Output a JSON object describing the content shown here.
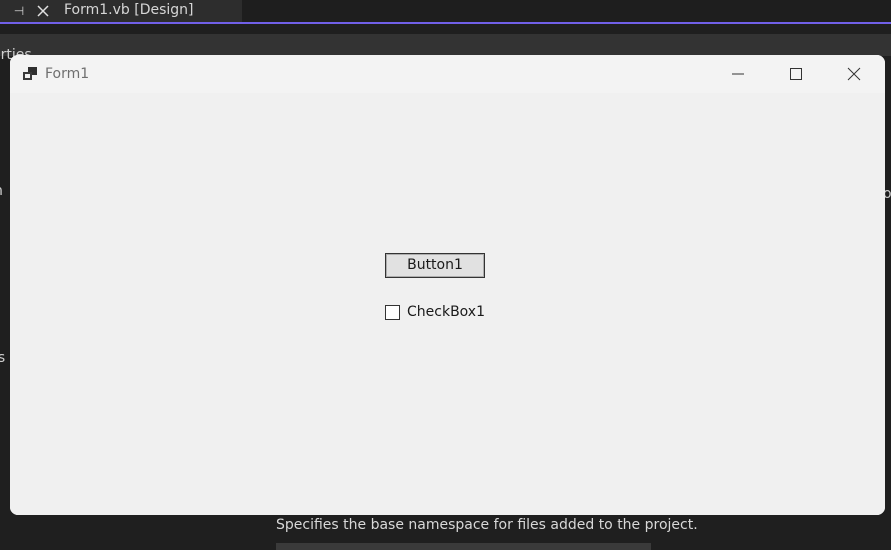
{
  "ide": {
    "tab": {
      "title": "Form1.vb [Design]",
      "pin_icon": "pin-icon",
      "close_icon": "close-icon"
    },
    "panels": {
      "properties_label_fragment": "erties",
      "left_fragment_1": "n",
      "left_fragment_2": "is",
      "right_fragment": "o"
    },
    "accent_color": "#7160e8"
  },
  "form": {
    "title": "Form1",
    "app_icon": "winforms-icon",
    "controls": {
      "minimize_icon": "minimize-icon",
      "maximize_icon": "maximize-icon",
      "close_icon": "close-icon"
    },
    "button1": {
      "label": "Button1"
    },
    "checkbox1": {
      "label": "CheckBox1",
      "checked": false
    }
  },
  "properties": {
    "description": "Specifies the base namespace for files added to the project."
  }
}
